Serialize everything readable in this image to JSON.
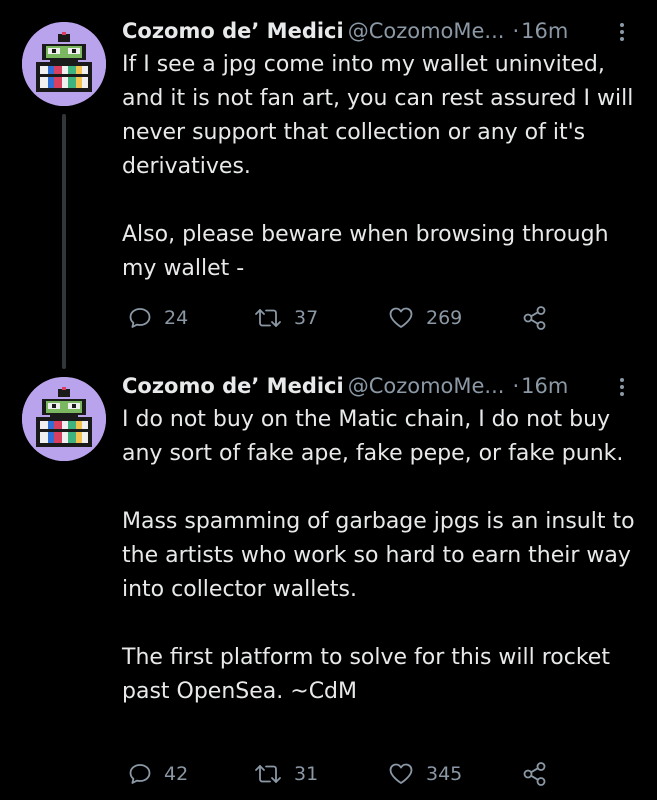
{
  "tweets": [
    {
      "author_name": "Cozomo de’ Medici",
      "handle": "@CozomoMe...",
      "separator": "·",
      "time": "16m",
      "paragraphs": [
        "If I see a jpg come into my wallet uninvited, and it is not fan art, you can rest assured I will never support that collection or any of it's derivatives.",
        "Also, please beware when browsing through my wallet -"
      ],
      "reply_count": "24",
      "retweet_count": "37",
      "like_count": "269"
    },
    {
      "author_name": "Cozomo de’ Medici",
      "handle": "@CozomoMe...",
      "separator": "·",
      "time": "16m",
      "paragraphs": [
        "I do not buy on the Matic chain, I do not buy any sort of fake ape, fake pepe, or fake punk.",
        "Mass spamming of garbage jpgs is an insult to the artists who work so hard to earn their way into collector wallets.",
        "The first platform to solve for this will rocket past OpenSea. ~CdM"
      ],
      "reply_count": "42",
      "retweet_count": "31",
      "like_count": "345"
    }
  ],
  "icons": {
    "avatar": "pixel-art-frog-avatar-icon",
    "more": "vertical-ellipsis-icon",
    "reply": "speech-bubble-icon",
    "retweet": "retweet-arrows-icon",
    "like": "heart-icon",
    "share": "share-nodes-icon"
  },
  "colors": {
    "background": "#000000",
    "primary_text": "#e7e9ea",
    "secondary_text": "#8b98a5",
    "avatar_background": "#b9a3ec",
    "thread_line": "#333639"
  }
}
